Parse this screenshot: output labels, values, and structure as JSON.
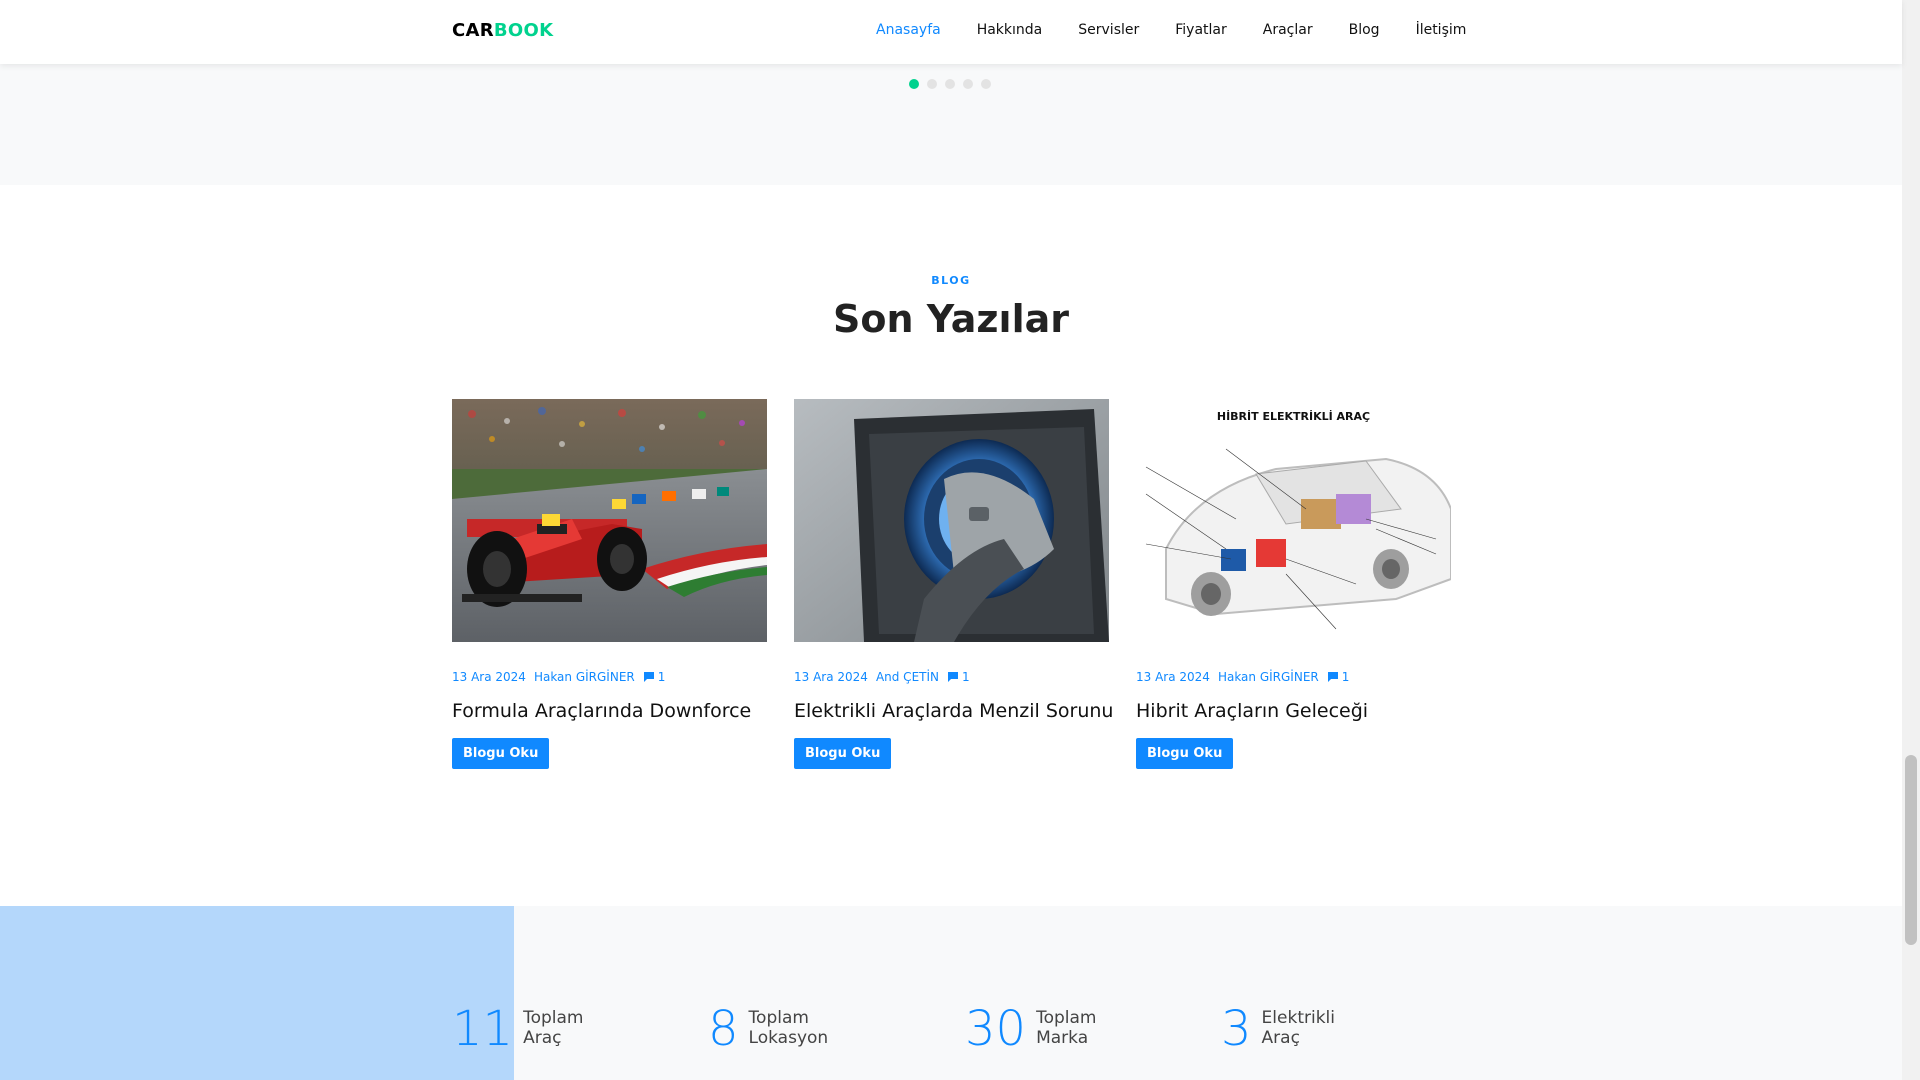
{
  "brand": {
    "part1": "CAR",
    "part2": "BOOK"
  },
  "nav": [
    "Anasayfa",
    "Hakkında",
    "Servisler",
    "Fiyatlar",
    "Araçlar",
    "Blog",
    "İletişim"
  ],
  "blog": {
    "kicker": "BLOG",
    "title": "Son Yazılar",
    "posts": [
      {
        "date": "13 Ara 2024",
        "author": "Hakan GİRGİNER",
        "comments": "1",
        "title": "Formula Araçlarında Downforce",
        "button": "Blogu Oku"
      },
      {
        "date": "13 Ara 2024",
        "author": "And ÇETİN",
        "comments": "1",
        "title": "Elektrikli Araçlarda Menzil Sorunu",
        "button": "Blogu Oku"
      },
      {
        "date": "13 Ara 2024",
        "author": "Hakan GİRGİNER",
        "comments": "1",
        "title": "Hibrit Araçların Geleceği",
        "button": "Blogu Oku",
        "image_caption": "HİBRİT ELEKTRİKLİ ARAÇ"
      }
    ]
  },
  "counters": [
    {
      "number": "11",
      "line1": "Toplam",
      "line2": "Araç"
    },
    {
      "number": "8",
      "line1": "Toplam",
      "line2": "Lokasyon"
    },
    {
      "number": "30",
      "line1": "Toplam",
      "line2": "Marka"
    },
    {
      "number": "3",
      "line1": "Elektrikli",
      "line2": "Araç"
    }
  ],
  "colors": {
    "primary": "#1089ff",
    "accent": "#01d28e"
  }
}
